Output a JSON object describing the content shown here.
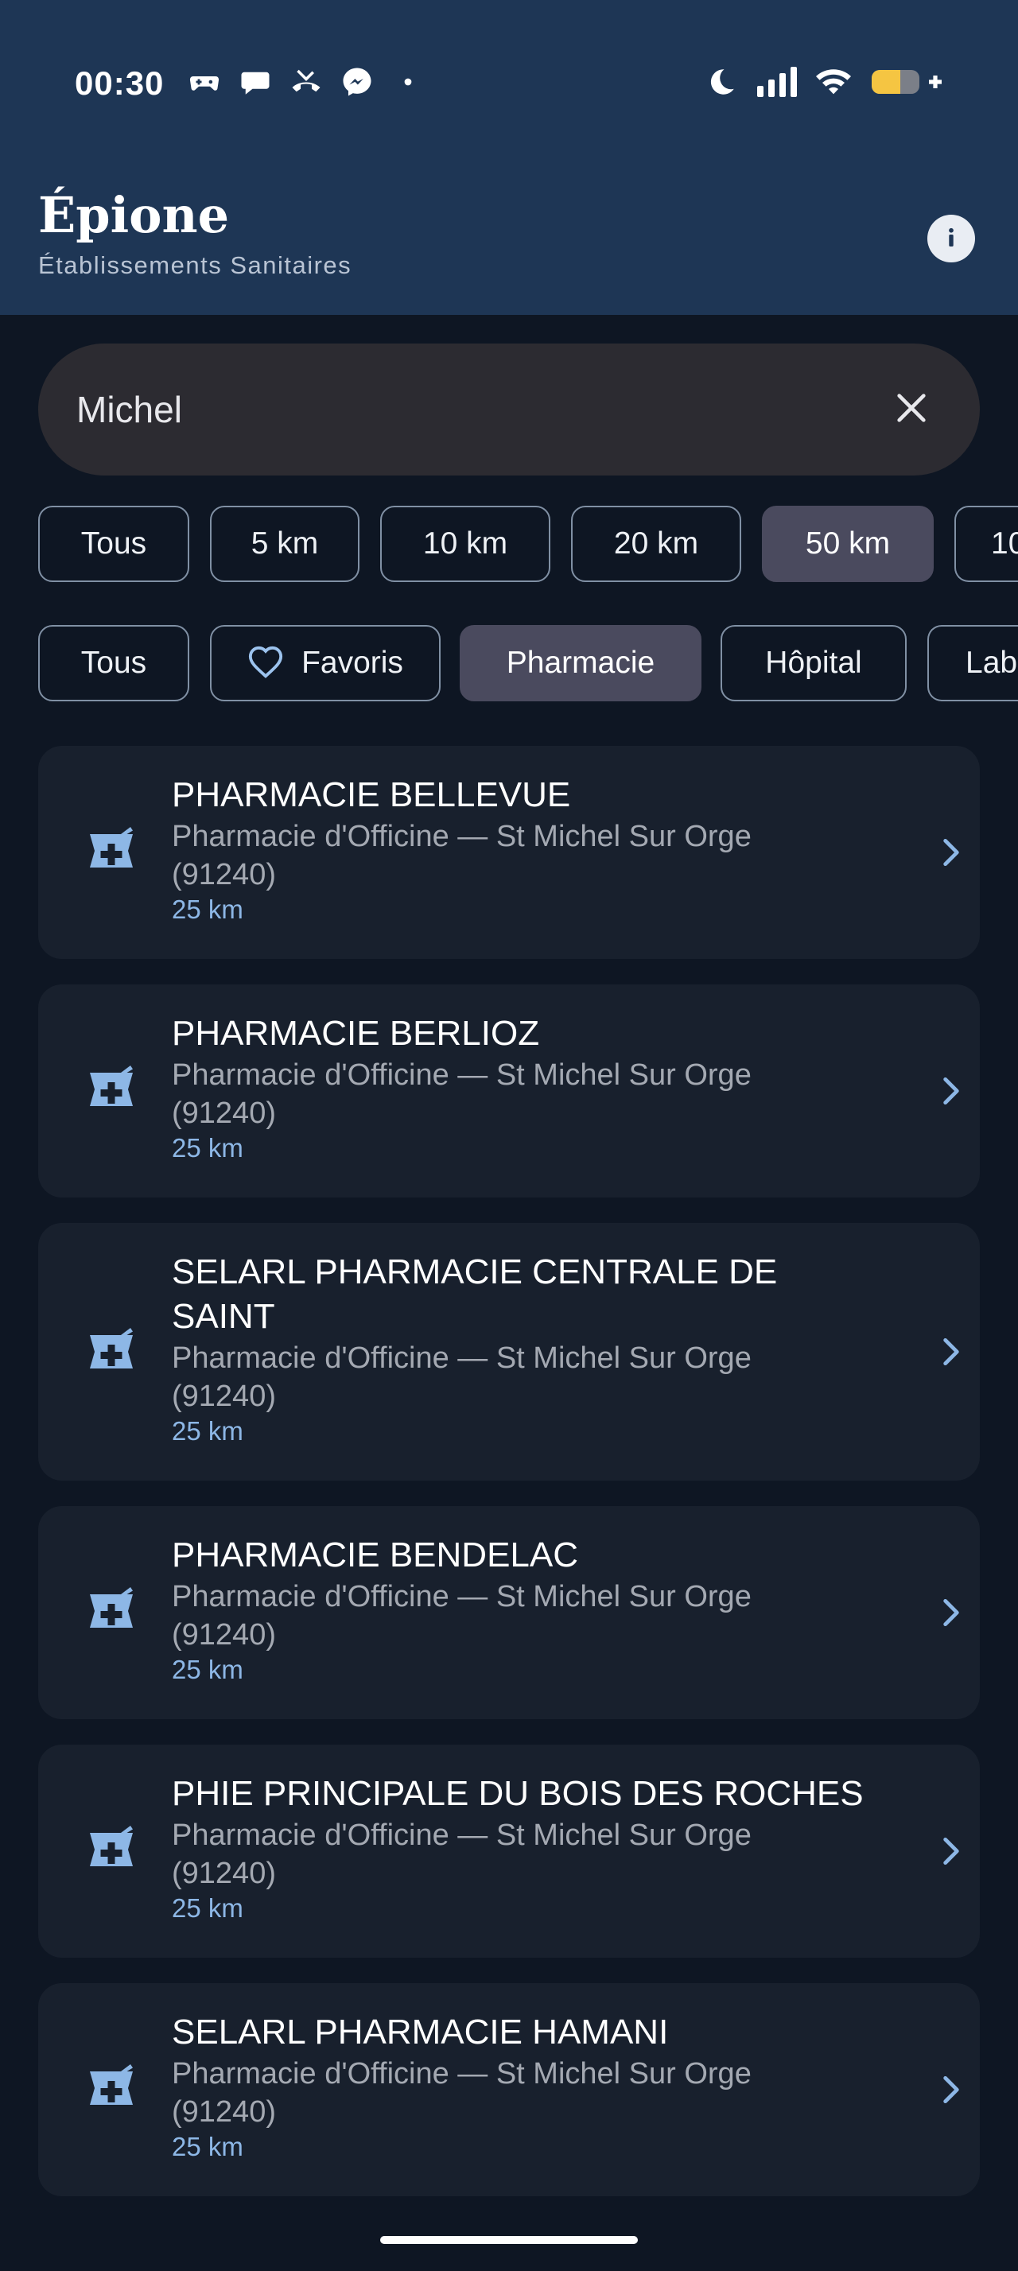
{
  "status_bar": {
    "time": "00:30",
    "left_icons": [
      "gamepad-icon",
      "chat-bubble-icon",
      "missed-call-icon",
      "messenger-icon",
      "dot-icon"
    ],
    "right_icons": [
      "moon-icon",
      "signal-icon",
      "wifi-icon",
      "battery-charging-icon"
    ]
  },
  "header": {
    "title": "Épione",
    "subtitle": "Établissements Sanitaires",
    "info_icon": "info-icon"
  },
  "search": {
    "value": "Michel",
    "clear_icon": "close-icon"
  },
  "distance_filters": [
    {
      "label": "Tous",
      "selected": false
    },
    {
      "label": "5 km",
      "selected": false
    },
    {
      "label": "10 km",
      "selected": false
    },
    {
      "label": "20 km",
      "selected": false
    },
    {
      "label": "50 km",
      "selected": true
    },
    {
      "label": "10",
      "selected": false
    }
  ],
  "category_filters": [
    {
      "label": "Tous",
      "selected": false
    },
    {
      "label": "Favoris",
      "icon": "heart-icon",
      "selected": false
    },
    {
      "label": "Pharmacie",
      "selected": true
    },
    {
      "label": "Hôpital",
      "selected": false
    },
    {
      "label": "Lab",
      "selected": false
    }
  ],
  "results": [
    {
      "name": "PHARMACIE BELLEVUE",
      "type_line1": "Pharmacie d'Officine — St Michel Sur Orge",
      "type_line2": "(91240)",
      "distance": "25 km"
    },
    {
      "name": "PHARMACIE BERLIOZ",
      "type_line1": "Pharmacie d'Officine — St Michel Sur Orge",
      "type_line2": "(91240)",
      "distance": "25 km"
    },
    {
      "name_line1": "SELARL PHARMACIE CENTRALE DE",
      "name_line2": "SAINT",
      "type_line1": "Pharmacie d'Officine — St Michel Sur Orge",
      "type_line2": "(91240)",
      "distance": "25 km"
    },
    {
      "name": "PHARMACIE BENDELAC",
      "type_line1": "Pharmacie d'Officine — St Michel Sur Orge",
      "type_line2": "(91240)",
      "distance": "25 km"
    },
    {
      "name": "PHIE PRINCIPALE DU BOIS DES ROCHES",
      "type_line1": "Pharmacie d'Officine — St Michel Sur Orge",
      "type_line2": "(91240)",
      "distance": "25 km"
    },
    {
      "name": "SELARL PHARMACIE HAMANI",
      "type_line1": "Pharmacie d'Officine — St Michel Sur Orge",
      "type_line2": "(91240)",
      "distance": "25 km"
    }
  ],
  "colors": {
    "header_bg": "#1e3655",
    "page_bg": "#0e1623",
    "card_bg": "#18202d",
    "accent": "#8db7e6",
    "chip_selected": "#4a4a5e"
  }
}
